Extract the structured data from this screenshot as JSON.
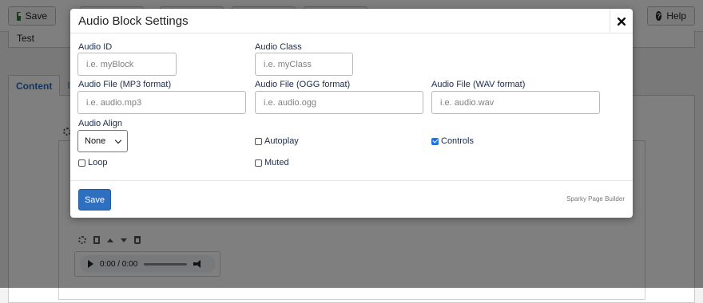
{
  "background": {
    "toolbar": {
      "save_label": "Save",
      "help_label": "Help"
    },
    "title_value": "Test",
    "tabs": [
      {
        "label": "Content",
        "active": true
      },
      {
        "label": "Ima",
        "active": false
      }
    ],
    "audio_player": {
      "time": "0:00 / 0:00"
    }
  },
  "modal": {
    "title": "Audio Block Settings",
    "fields": {
      "audio_id": {
        "label": "Audio ID",
        "placeholder": "i.e. myBlock",
        "value": ""
      },
      "audio_class": {
        "label": "Audio Class",
        "placeholder": "i.e. myClass",
        "value": ""
      },
      "audio_mp3": {
        "label": "Audio File (MP3 format)",
        "placeholder": "i.e. audio.mp3",
        "value": ""
      },
      "audio_ogg": {
        "label": "Audio File (OGG format)",
        "placeholder": "i.e. audio.ogg",
        "value": ""
      },
      "audio_wav": {
        "label": "Audio File (WAV format)",
        "placeholder": "i.e. audio.wav",
        "value": ""
      }
    },
    "align": {
      "label": "Audio Align",
      "selected": "None"
    },
    "checkboxes": {
      "autoplay": {
        "label": "Autoplay",
        "checked": false
      },
      "controls": {
        "label": "Controls",
        "checked": true
      },
      "loop": {
        "label": "Loop",
        "checked": false
      },
      "muted": {
        "label": "Muted",
        "checked": false
      }
    },
    "save_label": "Save",
    "brand": "Sparky Page Builder"
  },
  "colors": {
    "primary_button": "#2f6fbf",
    "checkbox_checked": "#1a73e8",
    "overlay": "rgba(0,0,0,0.5)"
  }
}
